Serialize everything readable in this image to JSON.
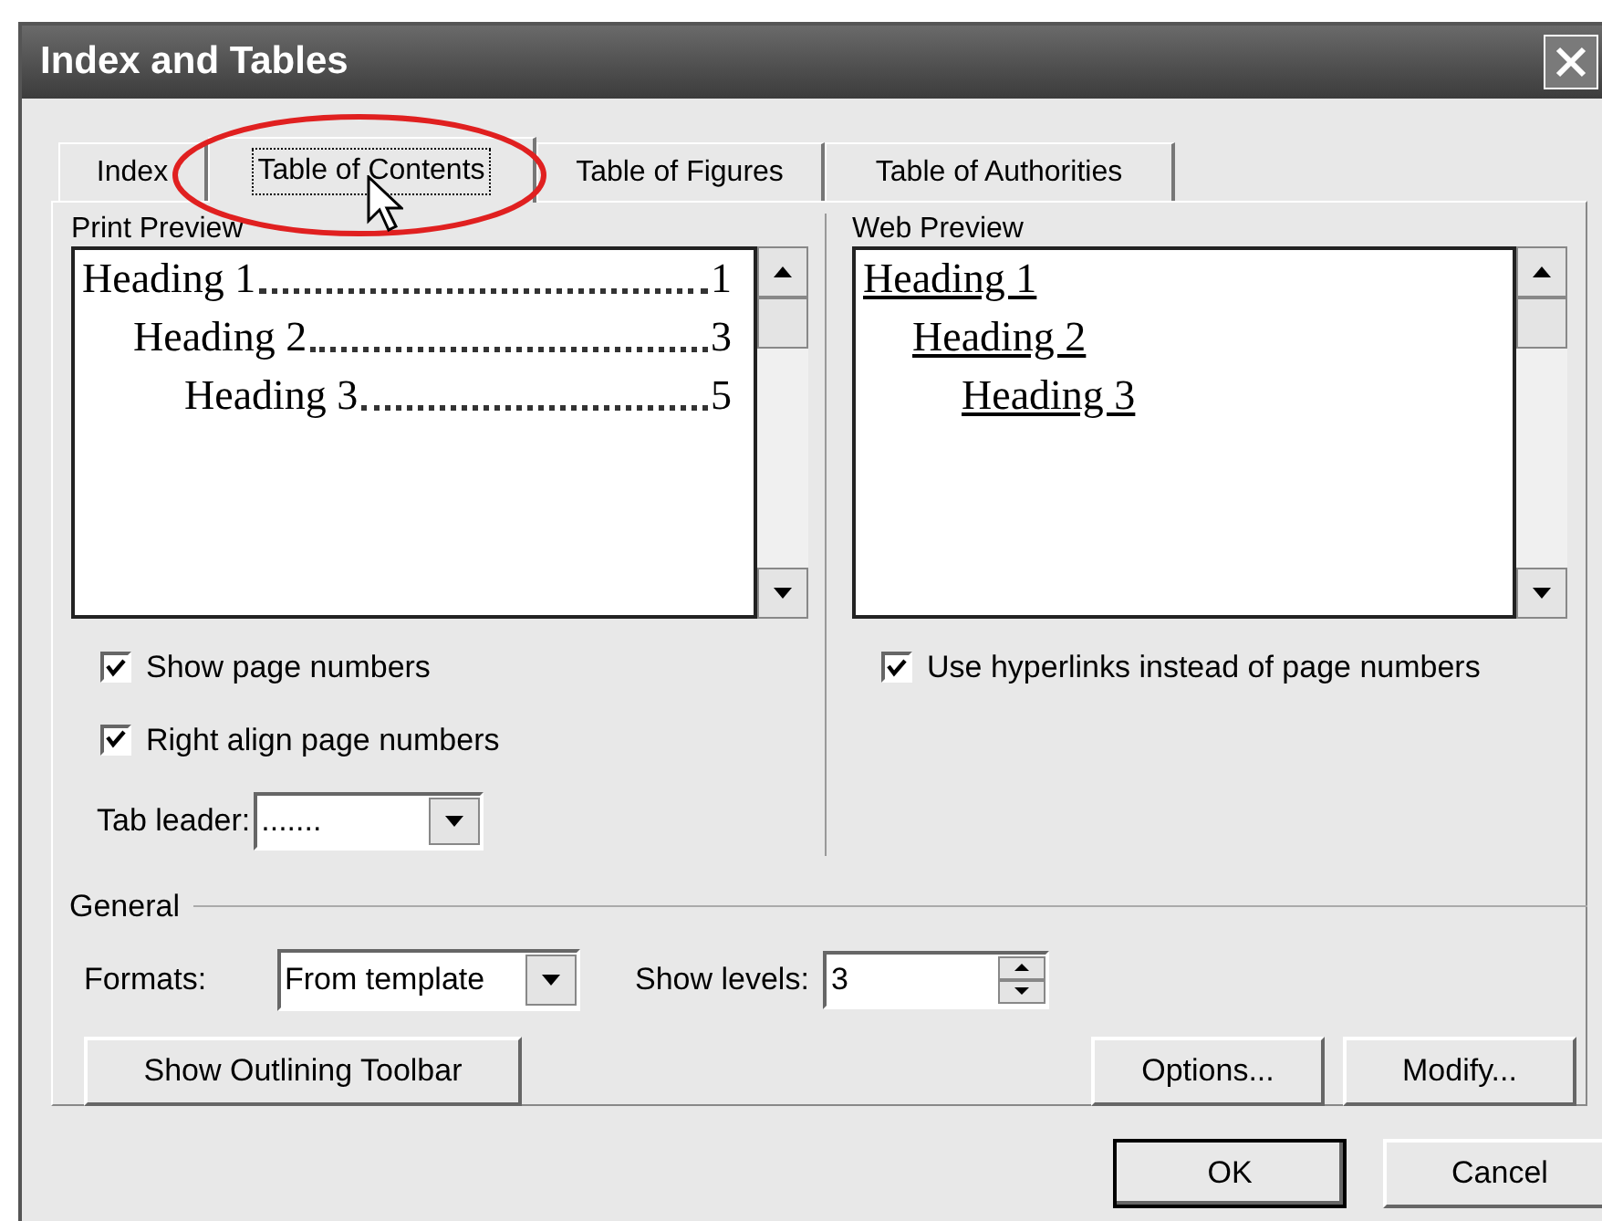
{
  "window": {
    "title": "Index and Tables"
  },
  "tabs": [
    {
      "label": "Index",
      "selected": false
    },
    {
      "label": "Table of Contents",
      "selected": true
    },
    {
      "label": "Table of Figures",
      "selected": false
    },
    {
      "label": "Table of Authorities",
      "selected": false
    }
  ],
  "print_preview": {
    "label": "Print Preview",
    "entries": [
      {
        "text": "Heading 1",
        "page": "1",
        "children": [
          {
            "text": "Heading 2",
            "page": "3",
            "children": [
              {
                "text": "Heading 3",
                "page": "5"
              }
            ]
          }
        ]
      }
    ]
  },
  "print_options": [
    {
      "label": "Show page numbers",
      "checked": true
    },
    {
      "label": "Right align page numbers",
      "checked": true
    }
  ],
  "tab_leader": {
    "label": "Tab leader:",
    "value": "......."
  },
  "web_preview": {
    "label": "Web Preview",
    "entries": [
      {
        "text": "Heading 1",
        "children": [
          {
            "text": "Heading 2",
            "children": [
              {
                "text": "Heading 3"
              }
            ]
          }
        ]
      }
    ]
  },
  "web_options": [
    {
      "label": "Use hyperlinks instead of page numbers",
      "checked": true
    }
  ],
  "general": {
    "label": "General",
    "formats": {
      "label": "Formats:",
      "value": "From template"
    },
    "show_levels": {
      "label": "Show levels:",
      "value": "3"
    }
  },
  "panel_buttons": [
    {
      "label": "Show Outlining Toolbar"
    },
    {
      "label": "Options..."
    },
    {
      "label": "Modify..."
    }
  ],
  "dialog_buttons": [
    {
      "label": "OK",
      "default": true
    },
    {
      "label": "Cancel",
      "default": false
    }
  ]
}
